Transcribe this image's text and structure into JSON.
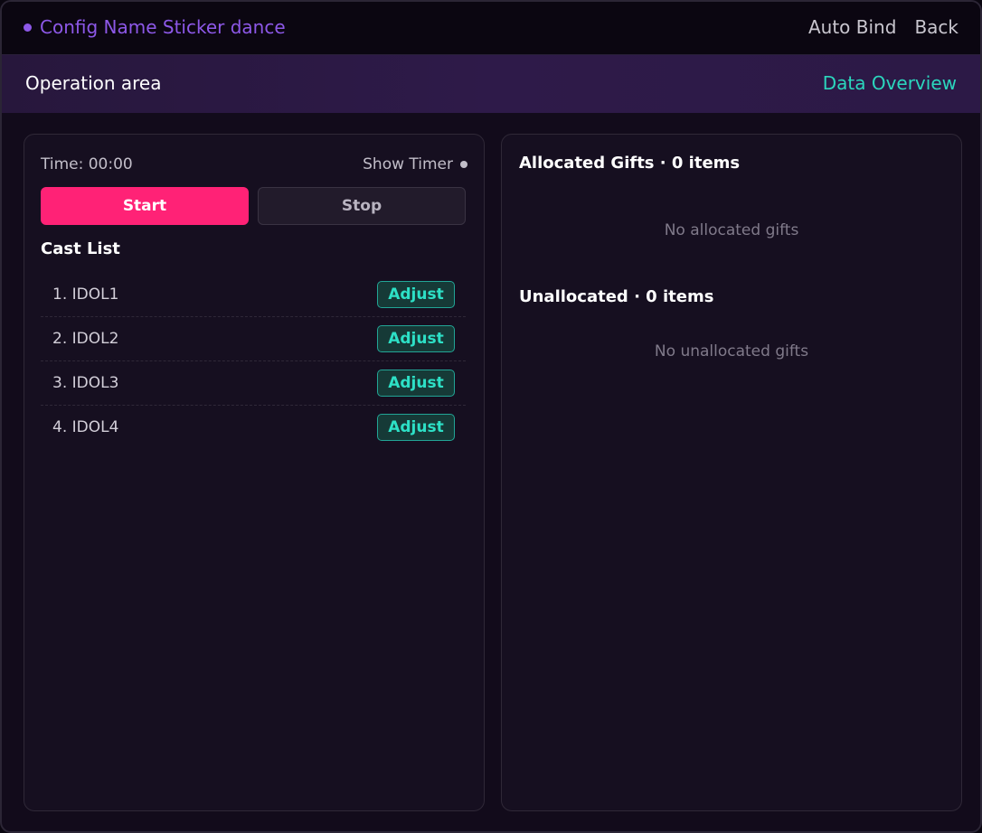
{
  "header": {
    "title": "Config Name Sticker dance",
    "auto_bind_label": "Auto Bind",
    "back_label": "Back"
  },
  "operation": {
    "title": "Operation area",
    "data_overview_label": "Data Overview"
  },
  "timer": {
    "time_text": "Time: 00:00",
    "show_timer_label": "Show Timer",
    "start_label": "Start",
    "stop_label": "Stop"
  },
  "cast": {
    "title": "Cast List",
    "items": [
      {
        "name": "1. IDOL1",
        "adjust_label": "Adjust"
      },
      {
        "name": "2. IDOL2",
        "adjust_label": "Adjust"
      },
      {
        "name": "3. IDOL3",
        "adjust_label": "Adjust"
      },
      {
        "name": "4. IDOL4",
        "adjust_label": "Adjust"
      }
    ]
  },
  "gifts": {
    "allocated_title": "Allocated Gifts · 0 items",
    "allocated_empty": "No allocated gifts",
    "unallocated_title": "Unallocated · 0 items",
    "unallocated_empty": "No unallocated gifts"
  },
  "colors": {
    "accent_purple": "#8d58e8",
    "start_pink": "#ff2276",
    "teal": "#2bd6bd"
  }
}
